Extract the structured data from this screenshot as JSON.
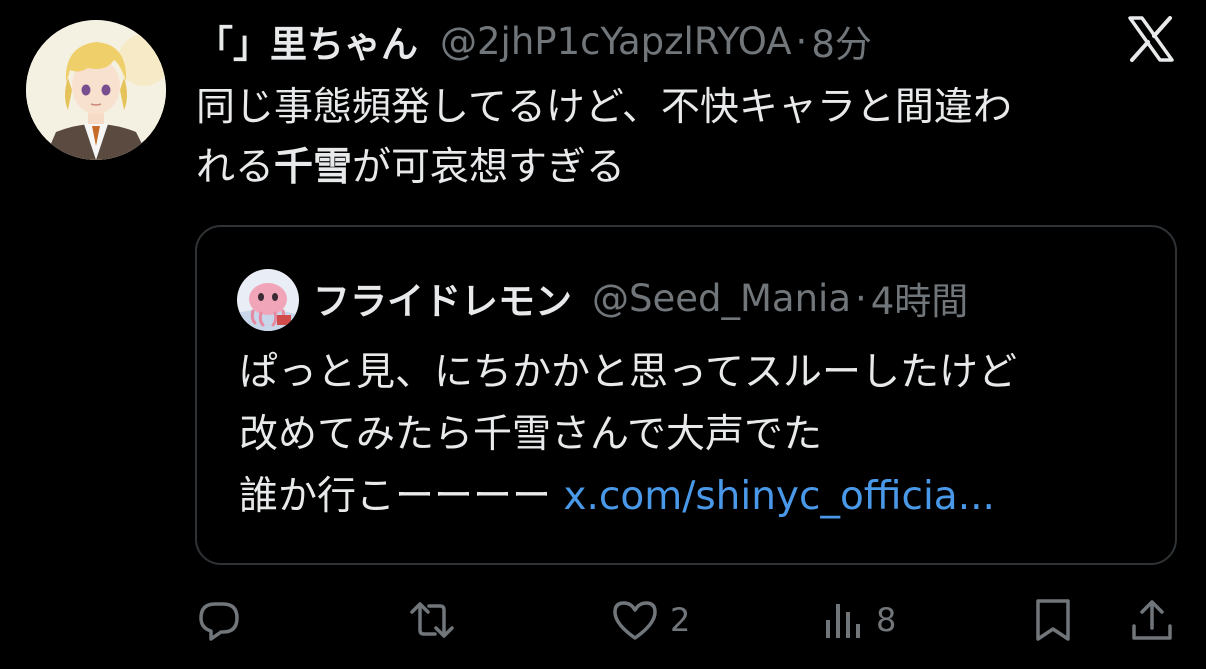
{
  "tweet": {
    "display_name": "「」里ちゃん",
    "handle": "@2jhP1cYapzlRYOA",
    "separator": "·",
    "time": "8分",
    "text_line1": "同じ事態頻発してるけど、不快キャラと間違わ",
    "text_line2_pre": "れる",
    "text_line2_bold": "千雪",
    "text_line2_post": "が可哀想すぎる"
  },
  "quoted": {
    "display_name": "フライドレモン",
    "handle": "@Seed_Mania",
    "separator": "·",
    "time": "4時間",
    "text_line1": "ぱっと見、にちかかと思ってスルーしたけど",
    "text_line2": "改めてみたら千雪さんで大声でた",
    "text_line3": "誰か行こーーーー",
    "link": "x.com/shinyc_officia..."
  },
  "actions": {
    "like_count": "2",
    "views_count": "8"
  },
  "colors": {
    "background": "#000000",
    "primary_text": "#e7e9ea",
    "secondary_text": "#71767b",
    "link": "#4a99e9",
    "border": "#2f3336"
  },
  "icons": [
    "x-logo-icon",
    "reply-icon",
    "repost-icon",
    "like-icon",
    "views-icon",
    "bookmark-icon",
    "share-icon"
  ]
}
